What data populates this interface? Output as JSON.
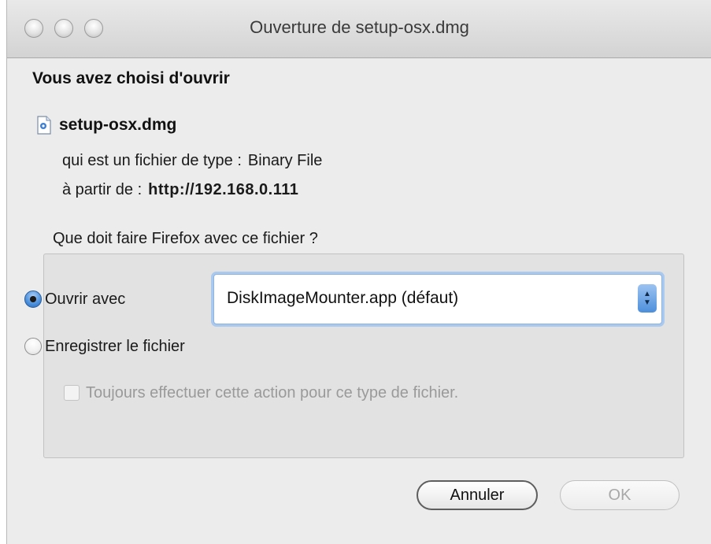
{
  "window": {
    "title": "Ouverture de setup-osx.dmg"
  },
  "dialog": {
    "heading": "Vous avez choisi d'ouvrir",
    "file_name": "setup-osx.dmg",
    "file_icon": "document-icon",
    "type_label": "qui est un fichier de type :",
    "type_value": "Binary File",
    "source_label": "à partir de :",
    "source_value": "http://192.168.0.111",
    "question": "Que doit faire Firefox avec ce fichier ?",
    "options": {
      "open_with_label": "Ouvrir avec",
      "open_with_selected": true,
      "application": "DiskImageMounter.app (défaut)",
      "save_label": "Enregistrer le fichier",
      "save_selected": false,
      "always_label": "Toujours effectuer cette action pour ce type de fichier.",
      "always_checked": false,
      "always_enabled": false
    },
    "buttons": {
      "cancel": "Annuler",
      "ok": "OK"
    }
  }
}
